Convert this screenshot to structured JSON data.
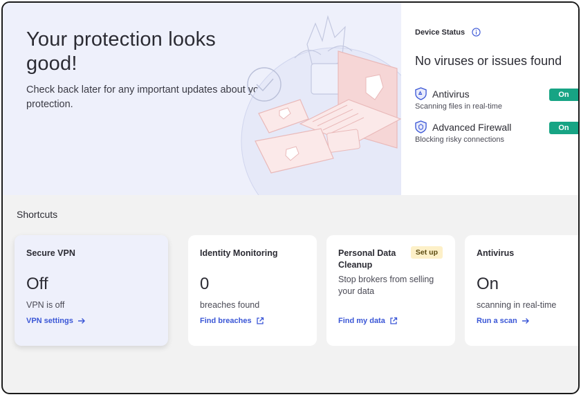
{
  "hero": {
    "title": "Your protection looks good!",
    "subtitle": "Check back later for any important updates about your protection."
  },
  "device_status": {
    "label": "Device Status",
    "message": "No viruses or issues found",
    "features": [
      {
        "name": "Antivirus",
        "description": "Scanning files in real-time",
        "toggle": "On"
      },
      {
        "name": "Advanced Firewall",
        "description": "Blocking risky connections",
        "toggle": "On"
      }
    ]
  },
  "shortcuts": {
    "title": "Shortcuts",
    "cards": [
      {
        "title": "Secure VPN",
        "value": "Off",
        "description": "VPN is off",
        "link": "VPN settings",
        "link_icon": "arrow-right-icon"
      },
      {
        "title": "Identity Monitoring",
        "value": "0",
        "description": "breaches found",
        "link": "Find breaches",
        "link_icon": "external-link-icon"
      },
      {
        "title": "Personal Data Cleanup",
        "badge": "Set up",
        "description": "Stop brokers from selling your data",
        "link": "Find my data",
        "link_icon": "external-link-icon"
      },
      {
        "title": "Antivirus",
        "value": "On",
        "description": "scanning in real-time",
        "link": "Run a scan",
        "link_icon": "arrow-right-icon"
      }
    ]
  },
  "colors": {
    "accent": "#3a56d6",
    "toggle_on": "#17a484",
    "hero_bg": "#eef0fb",
    "badge_bg": "#fdf0c8"
  }
}
